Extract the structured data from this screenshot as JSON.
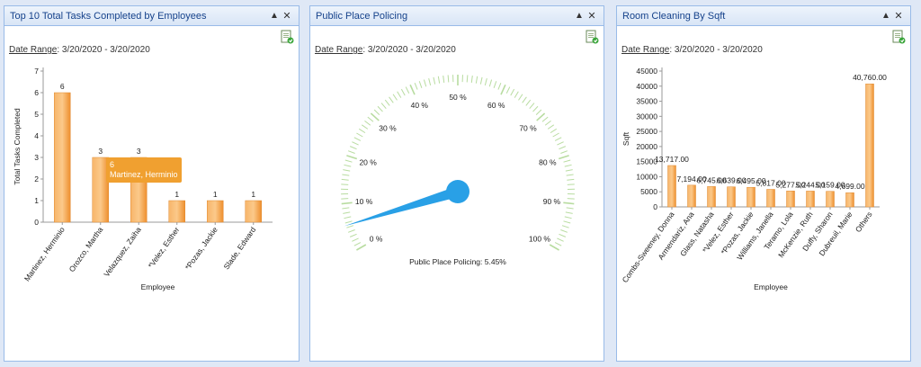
{
  "panels": [
    {
      "title": "Top 10 Total Tasks Completed by Employees",
      "date_range_label": "Date Range",
      "date_range_value": ": 3/20/2020 - 3/20/2020",
      "minimize_icon": "minimize-icon",
      "close_icon": "close-icon",
      "export_icon": "export-excel-icon",
      "tooltip": {
        "value": "6",
        "name": "Martinez, Herminio"
      }
    },
    {
      "title": "Public Place Policing",
      "date_range_label": "Date Range",
      "date_range_value": ": 3/20/2020 - 3/20/2020",
      "minimize_icon": "minimize-icon",
      "close_icon": "close-icon",
      "export_icon": "export-excel-icon"
    },
    {
      "title": "Room Cleaning By Sqft",
      "date_range_label": "Date Range",
      "date_range_value": ": 3/20/2020 - 3/20/2020",
      "minimize_icon": "minimize-icon",
      "close_icon": "close-icon",
      "export_icon": "export-excel-icon"
    }
  ],
  "header_buttons": {
    "minimize": "▲",
    "close": "✕"
  },
  "chart_data": [
    {
      "type": "bar",
      "title": "",
      "xlabel": "Employee",
      "ylabel": "Total Tasks Completed",
      "categories": [
        "Martinez, Herminio",
        "Orozco, Martha",
        "Velazquez, Zaiha",
        "*Velez, Esther",
        "*Pozas, Jackie",
        "Slade, Edward"
      ],
      "values": [
        6,
        3,
        3,
        1,
        1,
        1
      ],
      "data_labels": [
        "6",
        "3",
        "3",
        "1",
        "1",
        "1"
      ],
      "ylim": [
        0,
        7
      ],
      "yticks": [
        0,
        1,
        2,
        3,
        4,
        5,
        6,
        7
      ],
      "color": "#f5a04a"
    },
    {
      "type": "gauge",
      "title": "",
      "caption": "Public Place Policing: 5.45%",
      "value": 5.45,
      "range": [
        0,
        100
      ],
      "tick_labels": [
        "0 %",
        "10 %",
        "20 %",
        "30 %",
        "40 %",
        "50 %",
        "60 %",
        "70 %",
        "80 %",
        "90 %",
        "100 %"
      ],
      "needle_color": "#29a0e6",
      "tick_color": "#b8dca0"
    },
    {
      "type": "bar",
      "title": "",
      "xlabel": "Employee",
      "ylabel": "Sqft",
      "categories": [
        "Combs-Sweeney, Donna",
        "Armendariz, Ana",
        "Glass, Natasha",
        "*Velez, Esther",
        "*Pozas, Jackie",
        "Williams, Janella",
        "Teramo, Lola",
        "McKenzie, Ruth",
        "Duffy, Sharon",
        "Dubreuil, Marie",
        "Others"
      ],
      "values": [
        13717,
        7194,
        6745,
        6639,
        6495,
        5817,
        5277,
        5244,
        5159,
        4699,
        40760
      ],
      "data_labels": [
        "13,717.00",
        "7,194.00",
        "6,745.00",
        "6,639.00",
        "6,495.00",
        "5,817.00",
        "5,277.00",
        "5,244.00",
        "5,159.00",
        "4,699.00",
        "40,760.00"
      ],
      "ylim": [
        0,
        45000
      ],
      "yticks": [
        0,
        5000,
        10000,
        15000,
        20000,
        25000,
        30000,
        35000,
        40000,
        45000
      ],
      "color": "#f5a04a"
    }
  ]
}
